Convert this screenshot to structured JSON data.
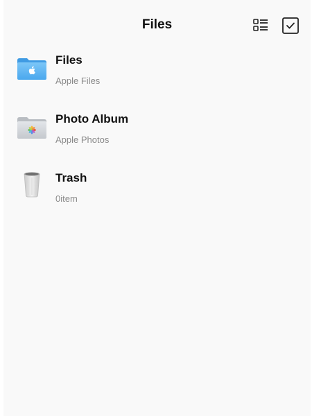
{
  "header": {
    "title": "Files",
    "list_view_icon": "list-view-icon",
    "select_icon": "checkbox-select-icon"
  },
  "items": [
    {
      "title": "Files",
      "subtitle": "Apple Files",
      "icon": "blue-folder-apple-icon",
      "accent": "#5ab4f2"
    },
    {
      "title": "Photo Album",
      "subtitle": "Apple Photos",
      "icon": "photos-folder-icon",
      "accent": "#c9cdd2"
    },
    {
      "title": "Trash",
      "subtitle": "0item",
      "icon": "trash-bin-icon",
      "accent": "#dadada"
    }
  ]
}
